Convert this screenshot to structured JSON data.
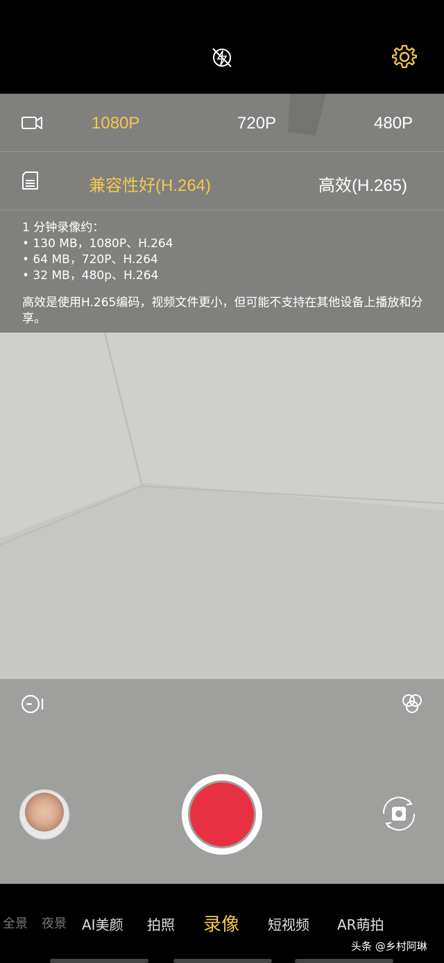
{
  "top_bar": {
    "flash_icon": "flash-auto-off-icon",
    "settings_icon": "gear-icon"
  },
  "settings_panel": {
    "resolution": {
      "icon": "video-camera-icon",
      "options": [
        "1080P",
        "720P",
        "480P"
      ],
      "selected": "1080P"
    },
    "codec": {
      "icon": "sd-card-icon",
      "options": [
        "兼容性好(H.264)",
        "高效(H.265)"
      ],
      "selected": "兼容性好(H.264)"
    },
    "info": {
      "heading": "1 分钟录像约：",
      "items": [
        "• 130 MB，1080P、H.264",
        "• 64 MB，720P、H.264",
        "• 32 MB，480p、H.264"
      ],
      "note": "高效是使用H.265编码，视频文件更小，但可能不支持在其他设备上播放和分享。"
    }
  },
  "controls": {
    "timer_icon": "timelapse-icon",
    "filter_icon": "filter-circles-icon",
    "switch_icon": "switch-camera-icon"
  },
  "modes": {
    "items": [
      "夜景",
      "AI美颜",
      "拍照",
      "录像",
      "短视频",
      "AR萌拍"
    ],
    "selected": "录像",
    "partial_left": "全景"
  },
  "watermark": "头条 @乡村阿琳",
  "colors": {
    "accent": "#f2c94c",
    "record": "#e83043"
  }
}
